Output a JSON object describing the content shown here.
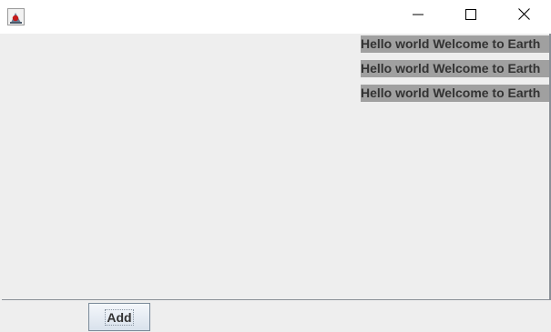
{
  "window": {
    "icon": "java-duke-icon",
    "controls": [
      "minimize-icon",
      "maximize-icon",
      "close-icon"
    ]
  },
  "labels": [
    "Hello world Welcome to Earth",
    "Hello world Welcome to Earth",
    "Hello world Welcome to Earth"
  ],
  "toolbar": {
    "add_label": "Add"
  },
  "colors": {
    "background": "#eeeeee",
    "titlebar": "#ffffff",
    "label_background": "#a0a0a0",
    "label_text": "#333333"
  }
}
